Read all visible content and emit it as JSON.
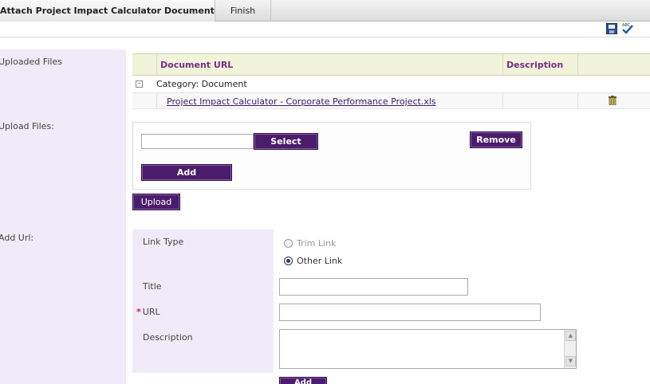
{
  "tabs": [
    {
      "label": "Attach Project Impact Calculator Document"
    },
    {
      "label": "Finish"
    }
  ],
  "toolbar": {
    "save_icon": "save-icon",
    "spellcheck_icon": "spellcheck-icon",
    "spellcheck_text": "ABC"
  },
  "sections": {
    "uploaded_files": "Uploaded Files",
    "upload_files": "Upload Files:",
    "add_url": "Add Url:"
  },
  "table": {
    "columns": [
      "Document URL",
      "Description"
    ],
    "category": "Category: Document",
    "rows": [
      {
        "document_url": "Project Impact Calculator - Corporate Performance Project.xls",
        "description": ""
      }
    ]
  },
  "upload": {
    "file_value": "",
    "select_label": "Select",
    "remove_label": "Remove",
    "add_label": "Add",
    "upload_label": "Upload"
  },
  "url_form": {
    "link_type_label": "Link Type",
    "options": [
      {
        "label": "Trim Link",
        "selected": false,
        "disabled": true
      },
      {
        "label": "Other Link",
        "selected": true,
        "disabled": false
      }
    ],
    "title_label": "Title",
    "title_value": "",
    "url_required": "*",
    "url_label": "URL",
    "url_value": "",
    "description_label": "Description",
    "description_value": "",
    "add_label": "Add"
  }
}
